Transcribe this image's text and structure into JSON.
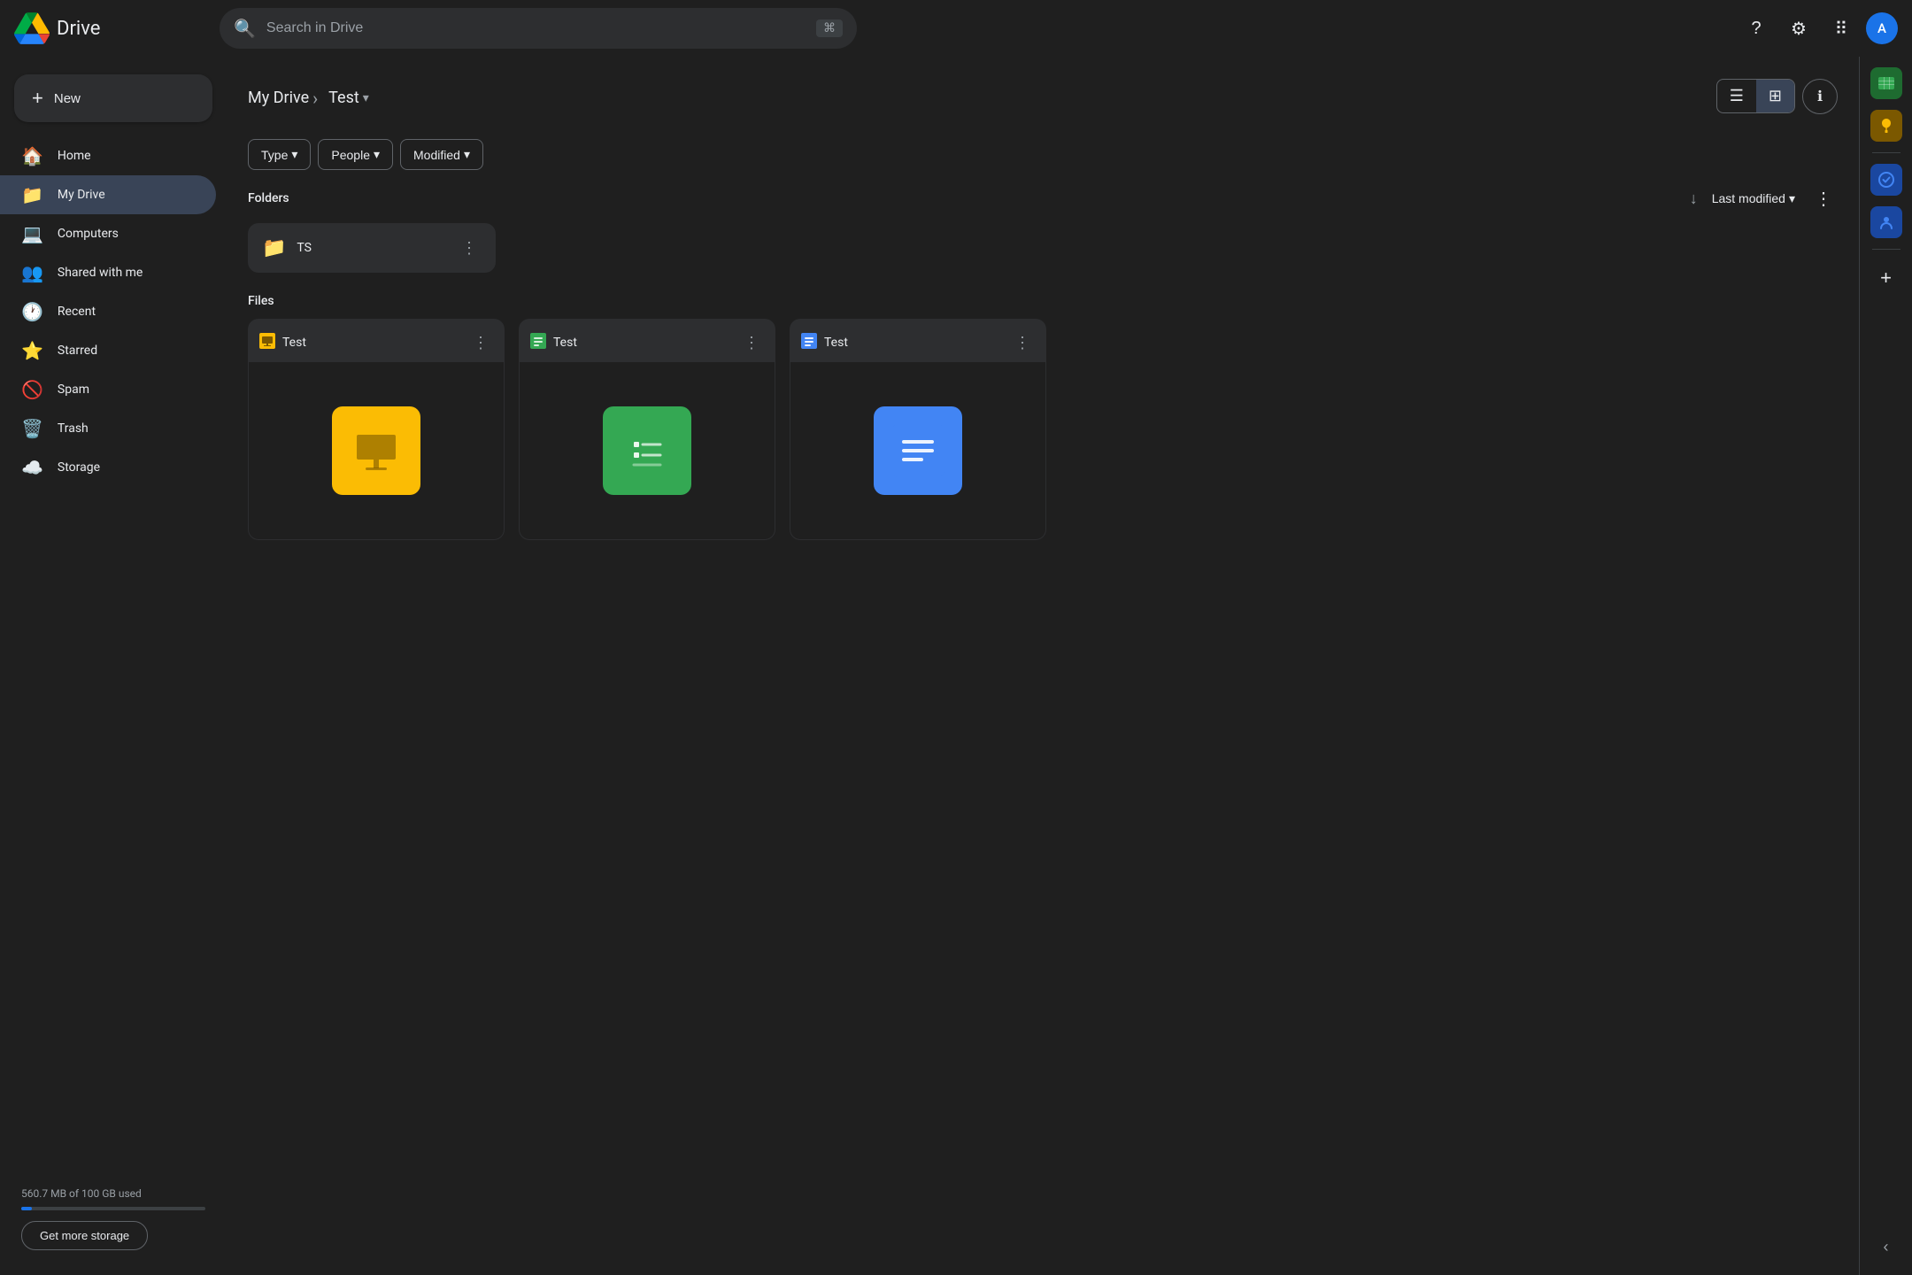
{
  "topbar": {
    "logo_text": "Drive",
    "search_placeholder": "Search in Drive",
    "keyboard_shortcut": "⌘",
    "avatar_initials": "A"
  },
  "sidebar": {
    "new_button_label": "New",
    "nav_items": [
      {
        "id": "home",
        "label": "Home",
        "icon": "🏠"
      },
      {
        "id": "my-drive",
        "label": "My Drive",
        "icon": "📁",
        "active": true
      },
      {
        "id": "computers",
        "label": "Computers",
        "icon": "💻"
      },
      {
        "id": "shared",
        "label": "Shared with me",
        "icon": "👥"
      },
      {
        "id": "recent",
        "label": "Recent",
        "icon": "🕐"
      },
      {
        "id": "starred",
        "label": "Starred",
        "icon": "⭐"
      },
      {
        "id": "spam",
        "label": "Spam",
        "icon": "🚫"
      },
      {
        "id": "trash",
        "label": "Trash",
        "icon": "🗑️"
      },
      {
        "id": "storage",
        "label": "Storage",
        "icon": "☁️"
      }
    ],
    "storage_used": "560.7 MB of 100 GB used",
    "get_storage_label": "Get more storage",
    "storage_percent": 5.6
  },
  "breadcrumb": {
    "parent": "My Drive",
    "current": "Test",
    "chevron_icon": "›",
    "dropdown_icon": "▾"
  },
  "filters": {
    "type_label": "Type",
    "people_label": "People",
    "modified_label": "Modified",
    "chevron": "▾"
  },
  "sort": {
    "down_arrow": "↓",
    "label": "Last modified",
    "chevron": "▾",
    "more": "⋮"
  },
  "sections": {
    "folders_title": "Folders",
    "files_title": "Files"
  },
  "folders": [
    {
      "name": "TS",
      "icon": "📁"
    }
  ],
  "files": [
    {
      "name": "Test",
      "type": "slides",
      "type_icon": "📊",
      "type_color": "#fbbc04",
      "preview_icon": "slides"
    },
    {
      "name": "Test",
      "type": "forms",
      "type_icon": "📋",
      "type_color": "#34a853",
      "preview_icon": "forms"
    },
    {
      "name": "Test",
      "type": "docs",
      "type_icon": "📄",
      "type_color": "#4285f4",
      "preview_icon": "docs"
    }
  ],
  "right_panel": {
    "items": [
      {
        "id": "sheets",
        "icon": "📊",
        "type": "sheets"
      },
      {
        "id": "keep",
        "icon": "📝",
        "type": "keep"
      },
      {
        "id": "tasks",
        "icon": "✓",
        "type": "tasks"
      },
      {
        "id": "contacts",
        "icon": "👤",
        "type": "contacts"
      },
      {
        "id": "add",
        "icon": "+",
        "type": "add"
      },
      {
        "id": "expand",
        "icon": "‹",
        "type": "expand"
      }
    ]
  },
  "view": {
    "list_icon": "☰",
    "grid_icon": "⊞",
    "info_icon": "ℹ"
  }
}
